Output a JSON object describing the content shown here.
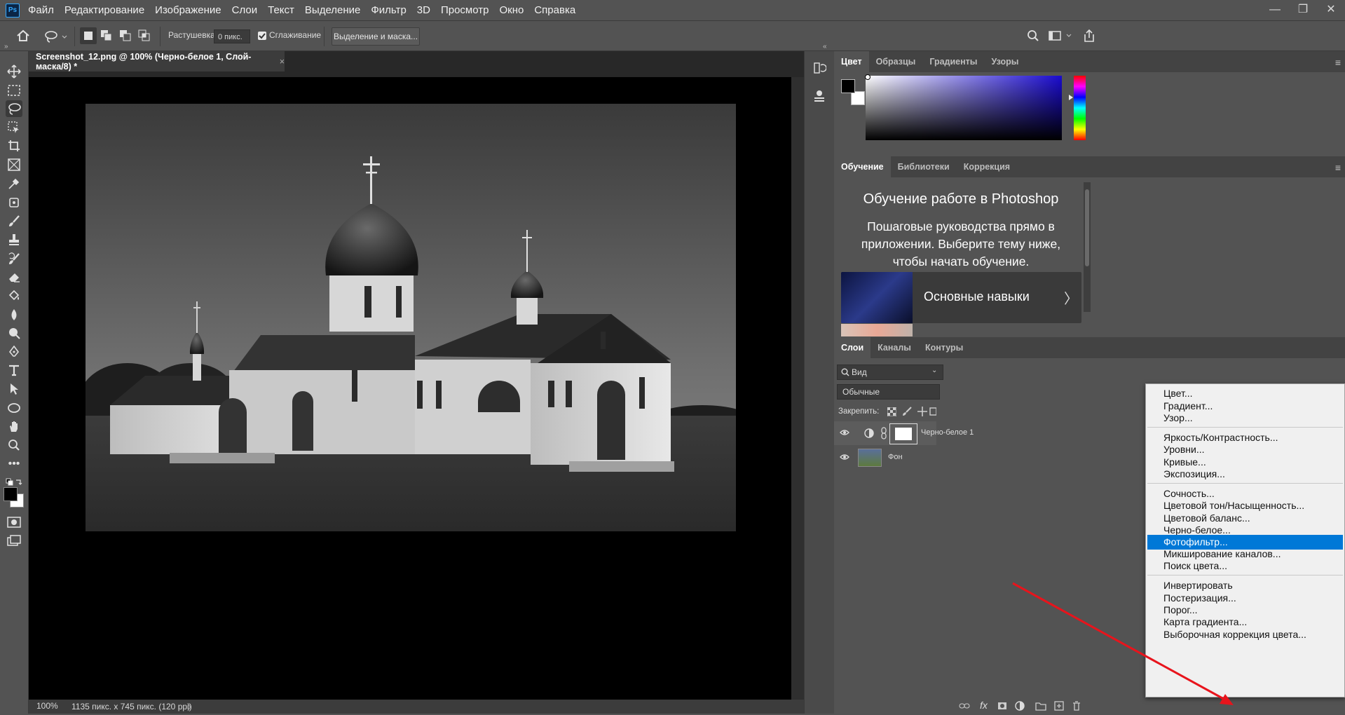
{
  "app": {
    "logo_text": "Ps"
  },
  "menubar": {
    "items": [
      "Файл",
      "Редактирование",
      "Изображение",
      "Слои",
      "Текст",
      "Выделение",
      "Фильтр",
      "3D",
      "Просмотр",
      "Окно",
      "Справка"
    ]
  },
  "window_controls": {
    "minimize": "—",
    "restore": "❐",
    "close": "✕"
  },
  "options_bar": {
    "feather_label": "Растушевка:",
    "feather_value": "0 пикс.",
    "antialias_label": "Сглаживание",
    "antialias_checked": true,
    "select_mask_button": "Выделение и маска..."
  },
  "document": {
    "tab_title": "Screenshot_12.png @ 100% (Черно-белое 1, Слой-маска/8) *",
    "tab_close": "×",
    "zoom": "100%",
    "info": "1135 пикс. x 745 пикс. (120 ppi)",
    "info_arrow": "〉"
  },
  "color_panel": {
    "tabs": [
      "Цвет",
      "Образцы",
      "Градиенты",
      "Узоры"
    ],
    "active_tab": "Цвет",
    "foreground_color": "#000000",
    "background_color": "#ffffff",
    "hue_color": "#1a0bcf"
  },
  "learn_panel": {
    "tabs": [
      "Обучение",
      "Библиотеки",
      "Коррекция"
    ],
    "active_tab": "Обучение",
    "heading": "Обучение работе в Photoshop",
    "description": "Пошаговые руководства прямо в приложении. Выберите тему ниже, чтобы начать обучение.",
    "card_title": "Основные навыки",
    "card_arrow": "〉"
  },
  "layers_panel": {
    "tabs": [
      "Слои",
      "Каналы",
      "Контуры"
    ],
    "active_tab": "Слои",
    "filter_value": "Вид",
    "blend_mode": "Обычные",
    "lock_label": "Закрепить:",
    "layers": [
      {
        "name": "Черно-белое 1"
      },
      {
        "name": "Фон"
      }
    ]
  },
  "adjustment_menu": {
    "groups": [
      [
        "Цвет...",
        "Градиент...",
        "Узор..."
      ],
      [
        "Яркость/Контрастность...",
        "Уровни...",
        "Кривые...",
        "Экспозиция..."
      ],
      [
        "Сочность...",
        "Цветовой тон/Насыщенность...",
        "Цветовой баланс...",
        "Черно-белое...",
        "Фотофильтр...",
        "Микширование каналов...",
        "Поиск цвета..."
      ],
      [
        "Инвертировать",
        "Постеризация...",
        "Порог...",
        "Карта градиента...",
        "Выборочная коррекция цвета..."
      ]
    ],
    "highlighted": "Фотофильтр..."
  },
  "colors": {
    "accent": "#0078d7",
    "arrow": "#e8141c",
    "panel_bg": "#535353"
  }
}
